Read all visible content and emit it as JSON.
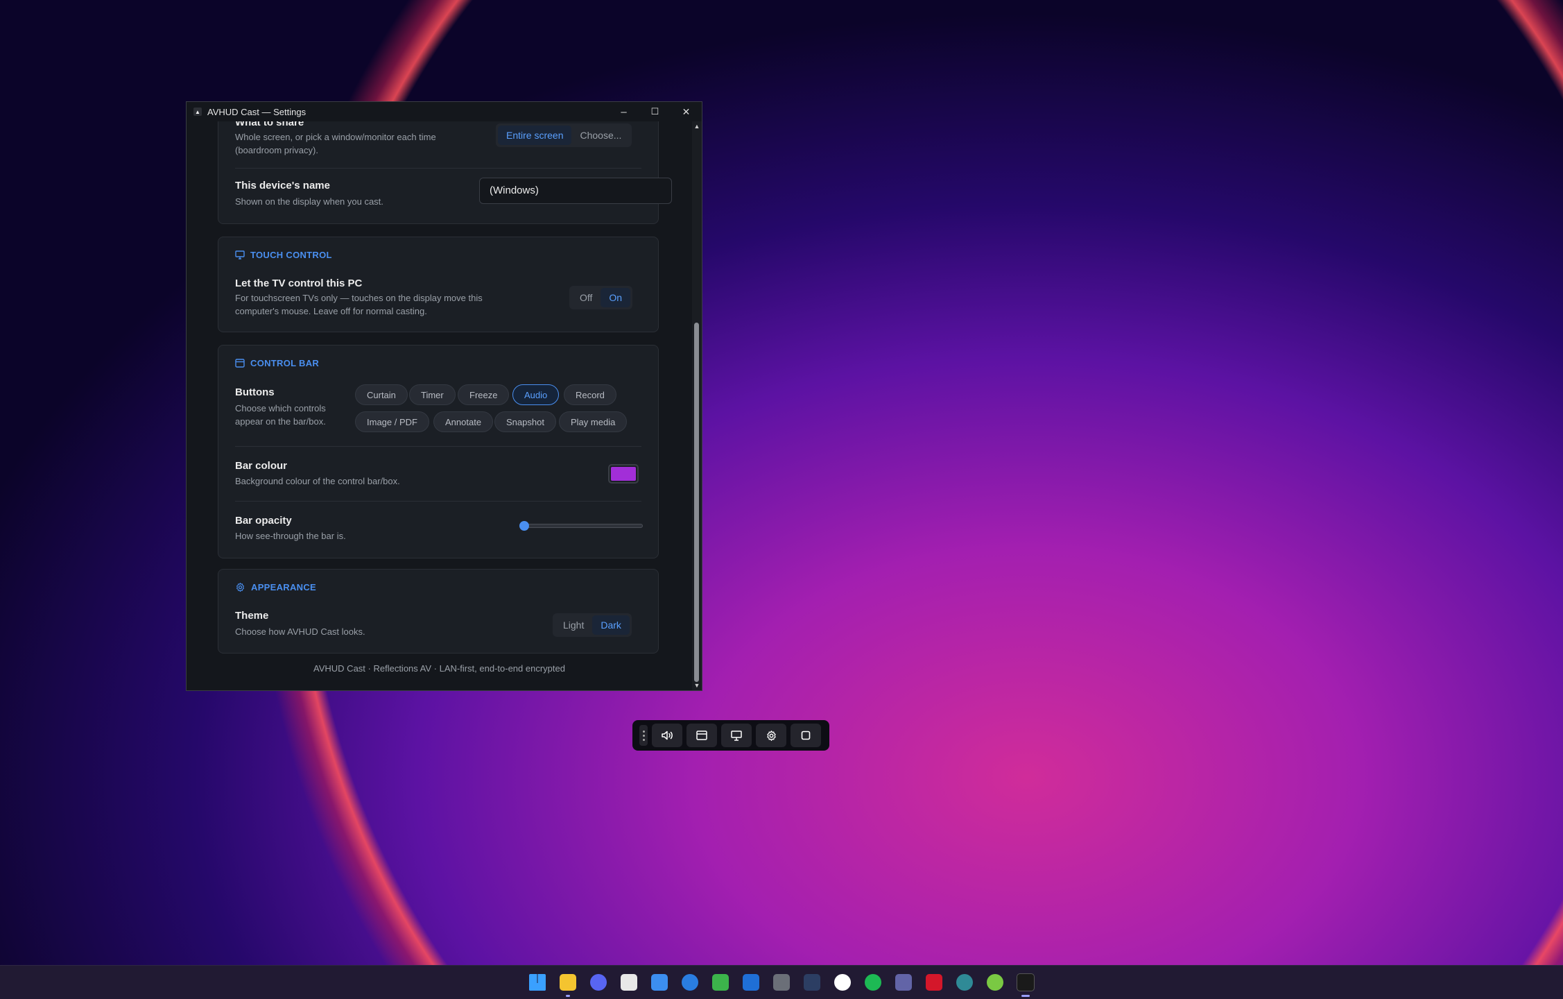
{
  "window": {
    "title": "AVHUD Cast — Settings",
    "minimize_glyph": "–",
    "maximize_glyph": "☐",
    "close_glyph": "✕"
  },
  "share": {
    "title": "What to share",
    "desc_line1": "Whole screen, or pick a window/monitor each time",
    "desc_line2": "(boardroom privacy).",
    "options": [
      "Entire screen",
      "Choose..."
    ],
    "selected": "Entire screen"
  },
  "device": {
    "title": "This device's name",
    "desc": "Shown on the display when you cast.",
    "value": "(Windows)"
  },
  "touch": {
    "heading": "TOUCH CONTROL",
    "title": "Let the TV control this PC",
    "desc_line1": "For touchscreen TVs only — touches on the display move this",
    "desc_line2": "computer's mouse. Leave off for normal casting.",
    "options": [
      "Off",
      "On"
    ],
    "selected": "On"
  },
  "control_bar": {
    "heading": "CONTROL BAR",
    "buttons": {
      "title": "Buttons",
      "desc_line1": "Choose which controls",
      "desc_line2": "appear on the bar/box.",
      "chips": [
        "Curtain",
        "Timer",
        "Freeze",
        "Audio",
        "Record",
        "Image / PDF",
        "Annotate",
        "Snapshot",
        "Play media"
      ],
      "selected": [
        "Audio"
      ]
    },
    "colour": {
      "title": "Bar colour",
      "desc": "Background colour of the control bar/box.",
      "value": "#a22ed8"
    },
    "opacity": {
      "title": "Bar opacity",
      "desc": "How see-through the bar is.",
      "value_fraction": 0.0
    }
  },
  "appearance": {
    "heading": "APPEARANCE",
    "title": "Theme",
    "desc": "Choose how AVHUD Cast looks.",
    "options": [
      "Light",
      "Dark"
    ],
    "selected": "Dark"
  },
  "footer": "AVHUD Cast · Reflections AV · LAN-first, end-to-end encrypted",
  "floating_bar_icons": [
    "audio-icon",
    "window-icon",
    "monitor-icon",
    "gear-icon",
    "stop-icon"
  ],
  "taskbar": [
    {
      "name": "start-icon",
      "color": "#3aa0ff"
    },
    {
      "name": "file-explorer-icon",
      "color": "#f4c430"
    },
    {
      "name": "discord-icon",
      "color": "#5865f2"
    },
    {
      "name": "cursor-icon",
      "color": "#e8e8e8"
    },
    {
      "name": "store-icon",
      "color": "#3c8ef0"
    },
    {
      "name": "app-blue-icon",
      "color": "#2a7de1"
    },
    {
      "name": "app-green-icon",
      "color": "#3cb44b"
    },
    {
      "name": "rdc-icon",
      "color": "#1f6fd6"
    },
    {
      "name": "calculator-icon",
      "color": "#6b6f78"
    },
    {
      "name": "terminal-icon",
      "color": "#2c3e63"
    },
    {
      "name": "app-store-icon",
      "color": "#ffffff"
    },
    {
      "name": "spotify-icon",
      "color": "#1db954"
    },
    {
      "name": "teams-icon",
      "color": "#6264a7"
    },
    {
      "name": "acrobat-icon",
      "color": "#d4172a"
    },
    {
      "name": "obs-icon",
      "color": "#2f8a96"
    },
    {
      "name": "app-check-icon",
      "color": "#7ac943"
    },
    {
      "name": "avhud-icon",
      "color": "#1a1a1a"
    }
  ]
}
